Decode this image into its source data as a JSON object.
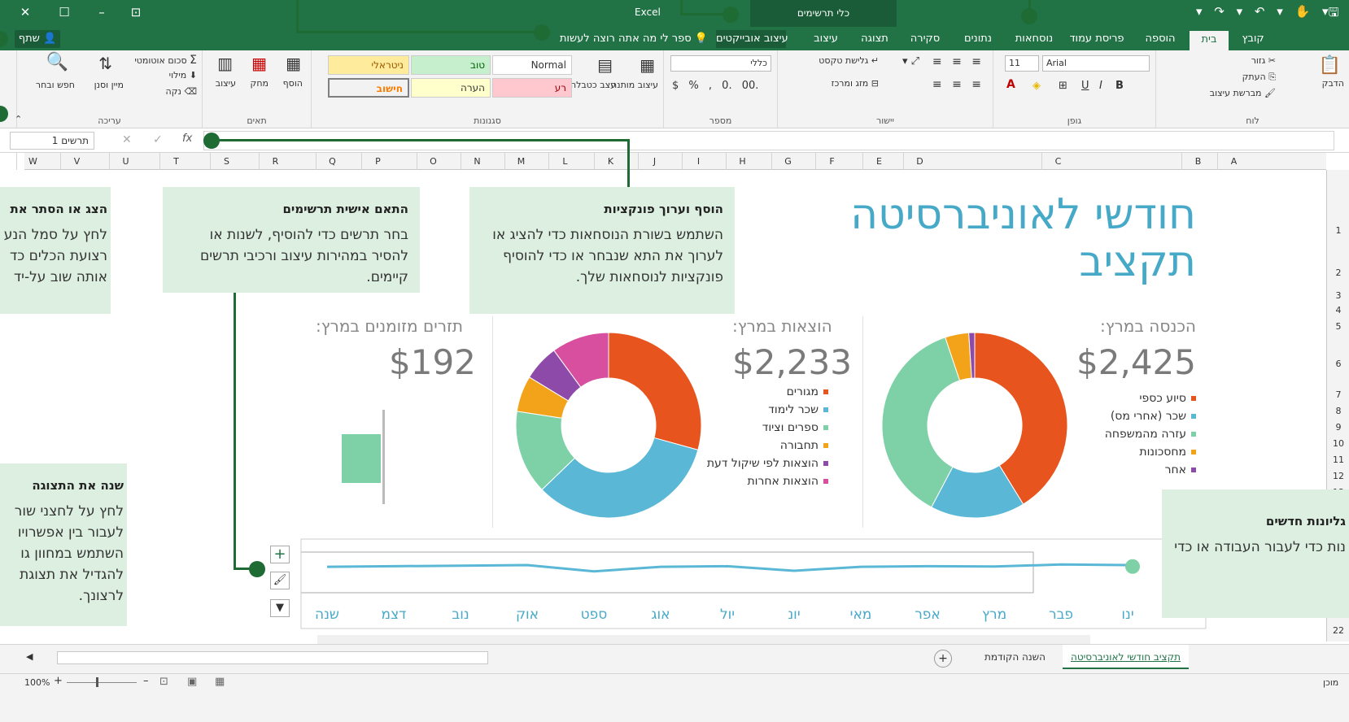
{
  "titlebar": {
    "app_title": "Excel",
    "context_title": "כלי תרשימים"
  },
  "tabs": {
    "file": "קובץ",
    "home": "בית",
    "insert": "הוספה",
    "page_layout": "פריסת עמוד",
    "formulas": "נוסחאות",
    "data": "נתונים",
    "review": "סקירה",
    "view": "תצוגה",
    "design": "עיצוב",
    "format": "עיצוב אובייקטים",
    "tellme": "ספר לי מה אתה רוצה לעשות",
    "share": "שתף"
  },
  "ribbon": {
    "clipboard": {
      "label": "לוח",
      "paste": "הדבק",
      "cut": "גזור",
      "copy": "העתק",
      "format_painter": "מברשת עיצוב"
    },
    "font": {
      "label": "גופן",
      "font_name": "Arial",
      "font_size": "11",
      "bold": "B",
      "italic": "I",
      "underline": "U"
    },
    "alignment": {
      "label": "יישור",
      "wrap_text": "גלישת טקסט",
      "merge_center": "מזג ומרכז"
    },
    "number": {
      "label": "מספר",
      "format": "כללי"
    },
    "styles": {
      "label": "סגנונות",
      "conditional": "עיצוב מותנה",
      "format_table": "עצב כטבלה",
      "normal": "Normal",
      "good": "טוב",
      "neutral": "ניטראלי",
      "bad": "רע",
      "note": "הערה",
      "calculation": "חישוב"
    },
    "cells": {
      "label": "תאים",
      "insert": "הוסף",
      "delete": "מחק",
      "format": "עיצוב"
    },
    "editing": {
      "label": "עריכה",
      "autosum": "סכום אוטומטי",
      "fill": "מילוי",
      "clear": "נקה",
      "sort_filter": "מיין וסנן",
      "find_select": "חפש ובחר"
    }
  },
  "formula_bar": {
    "name_box": "תרשים 1",
    "fx": "fx",
    "cancel": "✕",
    "enter": "✓"
  },
  "columns": [
    "A",
    "B",
    "C",
    "D",
    "E",
    "F",
    "G",
    "H",
    "I",
    "J",
    "K",
    "L",
    "M",
    "N",
    "O",
    "P",
    "Q",
    "R",
    "S",
    "T",
    "U",
    "V",
    "W"
  ],
  "rows": [
    "1",
    "2",
    "3",
    "4",
    "5",
    "6",
    "7",
    "8",
    "9",
    "10",
    "11",
    "12",
    "13",
    "22"
  ],
  "sheet": {
    "title_line1": "חודשי לאוניברסיטה",
    "title_line2": "תקציב",
    "income": {
      "label": "הכנסה במרץ:",
      "value": "$2,425"
    },
    "expenses": {
      "label": "הוצאות במרץ:",
      "value": "$2,233"
    },
    "cash": {
      "label": "תזרים מזומנים במרץ:",
      "value": "$192"
    }
  },
  "callouts": {
    "functions": {
      "title": "הוסף וערוך פונקציות",
      "body": "השתמש בשורת הנוסחאות כדי להציג או לערוך את התא שנבחר או כדי להוסיף פונקציות לנוסחאות שלך."
    },
    "charts": {
      "title": "התאם אישית תרשימים",
      "body": "בחר תרשים כדי להוסיף, לשנות או להסיר במהירות עיצוב ורכיבי תרשים קיימים."
    },
    "ribbon": {
      "title": "הצג או הסתר את",
      "body": "לחץ על סמל הנע רצועת הכלים כד אותה שוב על-יד"
    },
    "view": {
      "title": "שנה את התצוגה",
      "body": "לחץ על לחצני שור לעבור בין אפשרויו השתמש במחוון גו להגדיל את תצוגת לרצונך."
    },
    "sheets": {
      "title": "גליונות חדשים",
      "body": "נות כדי לעבור העבודה או כדי"
    }
  },
  "sheet_tabs": {
    "active": "תקציב חודשי לאוניברסיטה",
    "previous": "השנה הקודמת"
  },
  "status": {
    "ready": "מוכן",
    "zoom": "100%"
  },
  "colors": {
    "excel_green": "#217346",
    "accent_teal": "#47a9c8",
    "callout_bg": "#dcefe0"
  },
  "chart_data": [
    {
      "type": "pie",
      "title": "הכנסה במרץ:",
      "categories": [
        "סיוע כספי",
        "שכר (אחרי מס)",
        "עזרה מהמשפחה",
        "מחסכונות",
        "אחר"
      ],
      "values": [
        1000,
        400,
        900,
        100,
        25
      ],
      "colors": [
        "#e8541e",
        "#5ab8d6",
        "#7ed1a6",
        "#f2a31a",
        "#8e4aa8"
      ]
    },
    {
      "type": "pie",
      "title": "הוצאות במרץ:",
      "categories": [
        "מגורים",
        "שכר לימוד",
        "ספרים וציוד",
        "תחבורה",
        "הוצאות לפי שיקול דעת",
        "הוצאות אחרות"
      ],
      "values": [
        700,
        800,
        350,
        150,
        150,
        240
      ],
      "colors": [
        "#e8541e",
        "#5ab8d6",
        "#7ed1a6",
        "#f2a31a",
        "#8e4aa8",
        "#d94fa0"
      ]
    },
    {
      "type": "line",
      "categories": [
        "ינו",
        "פבר",
        "מרץ",
        "אפר",
        "מאי",
        "יונ",
        "יול",
        "אוג",
        "ספט",
        "אוק",
        "נוב",
        "דצמ",
        "שנה"
      ],
      "values": [
        60,
        62,
        55,
        56,
        54,
        40,
        56,
        54,
        38,
        60,
        58,
        56,
        54
      ],
      "ylim": [
        0,
        100
      ]
    }
  ]
}
